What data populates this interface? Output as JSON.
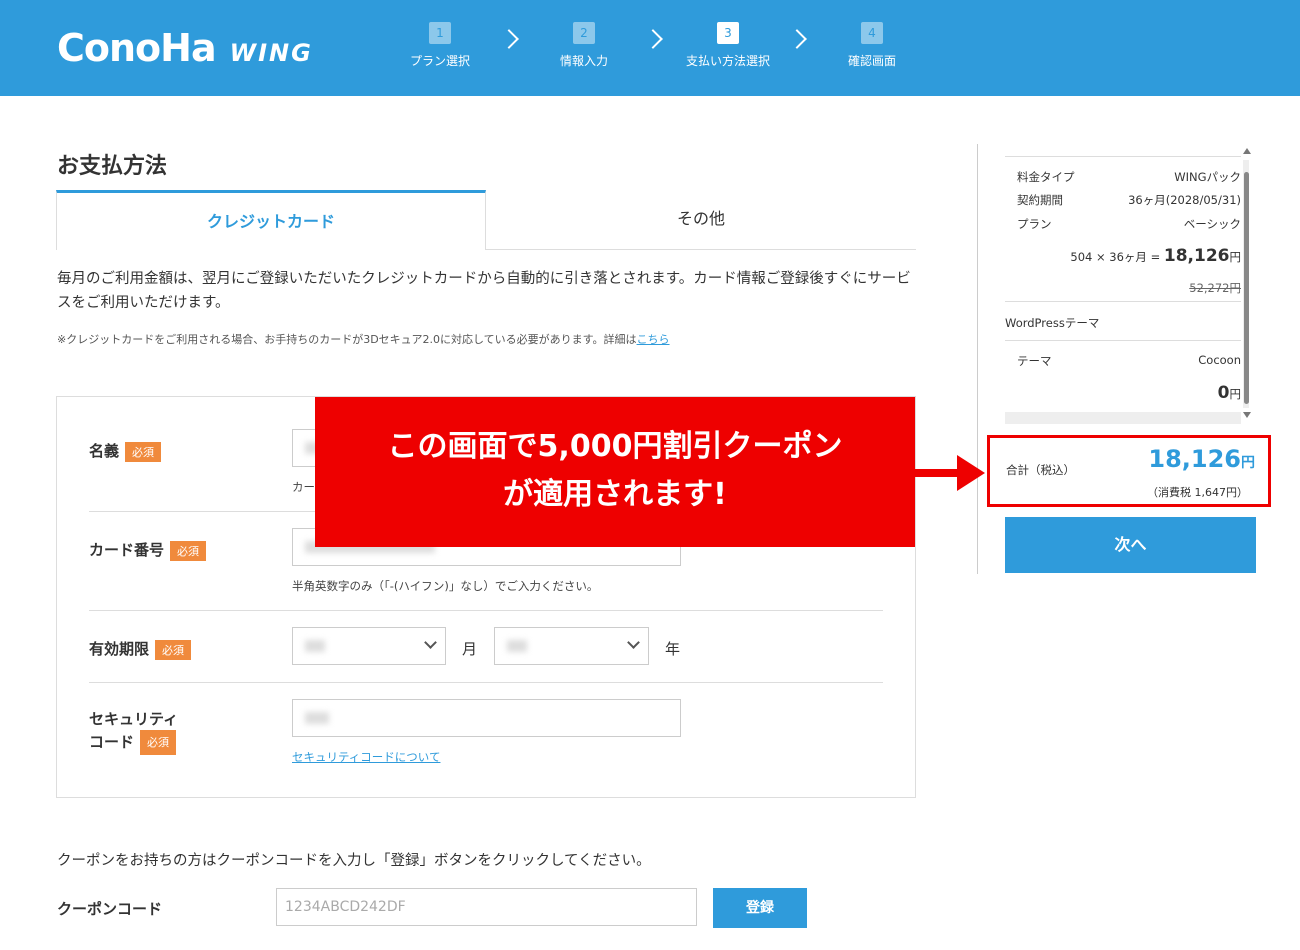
{
  "header": {
    "logo_main": "ConoHa",
    "logo_sub": "WING",
    "steps": [
      {
        "num": "1",
        "label": "プラン選択"
      },
      {
        "num": "2",
        "label": "情報入力"
      },
      {
        "num": "3",
        "label": "支払い方法選択"
      },
      {
        "num": "4",
        "label": "確認画面"
      }
    ],
    "active_step": 3
  },
  "main": {
    "title": "お支払方法",
    "tabs": [
      {
        "label": "クレジットカード"
      },
      {
        "label": "その他"
      }
    ],
    "description": "毎月のご利用金額は、翌月にご登録いただいたクレジットカードから自動的に引き落とされます。カード情報ご登録後すぐにサービスをご利用いただけます。",
    "note_prefix": "※クレジットカードをご利用される場合、お手持ちのカードが3Dセキュア2.0に対応している必要があります。詳細は",
    "note_link": "こちら",
    "form": {
      "required_label": "必須",
      "name_label": "名義",
      "name_hint": "カー",
      "card_label": "カード番号",
      "card_hint": "半角英数字のみ（「-(ハイフン)」なし）でご入力ください。",
      "expiry_label": "有効期限",
      "month_unit": "月",
      "year_unit": "年",
      "security_label_1": "セキュリティ",
      "security_label_2": "コード",
      "security_link": "セキュリティコードについて"
    },
    "coupon": {
      "description": "クーポンをお持ちの方はクーポンコードを入力し「登録」ボタンをクリックしてください。",
      "label": "クーポンコード",
      "placeholder": "1234ABCD242DF",
      "button": "登録"
    }
  },
  "banner": {
    "line1": "この画面で5,000円割引クーポン",
    "line2": "が適用されます!"
  },
  "sidebar": {
    "rows": [
      {
        "key": "料金タイプ",
        "value": "WINGパック"
      },
      {
        "key": "契約期間",
        "value": "36ヶ月(2028/05/31)"
      },
      {
        "key": "プラン",
        "value": "ベーシック"
      }
    ],
    "calc": "504 × 36ヶ月 =",
    "price": "18,126",
    "yen": "円",
    "old_price": "52,272円",
    "wp_theme_title": "WordPressテーマ",
    "theme_key": "テーマ",
    "theme_value": "Cocoon",
    "theme_price": "0",
    "total_label": "合計（税込）",
    "total_value": "18,126",
    "total_tax": "（消費税 1,647円）",
    "next_button": "次へ"
  },
  "colors": {
    "brand": "#2f9bdb",
    "highlight": "#ee0000",
    "required": "#f08a3c"
  }
}
